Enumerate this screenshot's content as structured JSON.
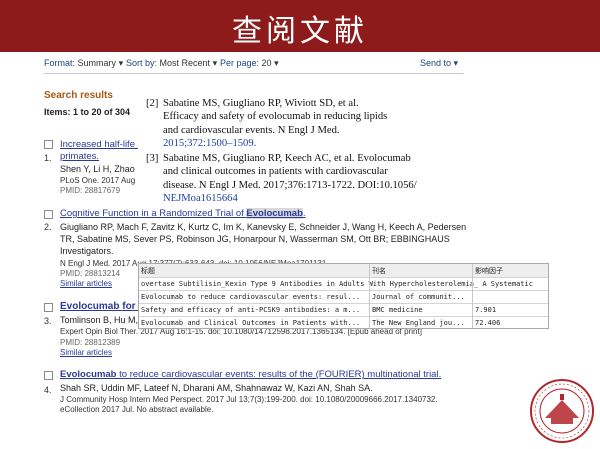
{
  "slide": {
    "title": "查阅文献"
  },
  "toolbar": {
    "format_label": "Format:",
    "format_value": "Summary",
    "sort_label": "Sort by:",
    "sort_value": "Most Recent",
    "per_page_label": "Per page:",
    "per_page_value": "20",
    "send_to": "Send to"
  },
  "results_header": {
    "title": "Search results",
    "items": "Items: 1 to 20 of 304"
  },
  "results": [
    {
      "title_parts": [
        "Increased half-life a",
        "primates."
      ],
      "number": "1.",
      "authors": "Shen Y, Li H, Zhao I",
      "journal": "PLoS One. 2017 Aug 1",
      "pmid": "PMID: 28817679"
    },
    {
      "title_prefix": "Cognitive Function in a Randomized Trial of ",
      "title_highlight": "Evolocumab",
      "title_suffix": ".",
      "number": "2.",
      "authors_1": "Giugliano RP, Mach F, Zavitz K, Kurtz C, Im K, Kanevsky E, Schneider J, Wang H, Keech A, Pedersen",
      "authors_2": "TR, Sabatine MS, Sever PS, Robinson JG, Honarpour N, Wasserman SM, Ott BR; EBBINGHAUS",
      "authors_3": "Investigators.",
      "journal": "N Engl J Med. 2017 Aug 17;377(7):633-643. doi: 10.1056/NEJMoa1701131.",
      "pmid": "PMID: 28813214",
      "similar": "Similar articles"
    },
    {
      "title": "Evolocumab for th",
      "number": "3.",
      "authors": "Tomlinson B, Hu M,",
      "journal": "Expert Opin Biol Ther. 2017 Aug 16:1-15. doi: 10.1080/14712598.2017.1365134. [Epub ahead of print]",
      "pmid": "PMID: 28812389",
      "similar": "Similar articles"
    },
    {
      "title_highlight": "Evolocumab",
      "title_suffix": " to reduce cardiovascular events: results of the (FOURIER) multinational trial.",
      "number": "4.",
      "authors": "Shah SR, Uddin MF, Lateef N, Dharani AM, Shahnawaz W, Kazi AN, Shah SA.",
      "journal_1": "J Community Hosp Intern Med Perspect. 2017 Jul 13;7(3):199-200. doi: 10.1080/20009666.2017.1340732.",
      "journal_2": "eCollection 2017 Jul. No abstract available."
    }
  ],
  "references": [
    {
      "number": "[2]",
      "lines": [
        "Sabatine MS, Giugliano RP, Wiviott SD, et al.",
        "Efficacy and safety of evolocumab in reducing lipids",
        "and cardiovascular events. N Engl J Med.",
        "2015;372:1500–1509."
      ]
    },
    {
      "number": "[3]",
      "lines": [
        "Sabatine MS, Giugliano RP, Keech AC, et al. Evolocumab",
        "and clinical outcomes in patients with cardiovascular",
        "disease. N Engl J Med. 2017;376:1713-1722. DOI:10.1056/",
        "NEJMoa1615664"
      ]
    }
  ],
  "table": {
    "headers": [
      "标题",
      "刊名",
      "影响因子"
    ],
    "rows": [
      [
        "overtase Subtilisin_Kexin Type 9 Antibodies in Adults With Hypercholesterolemia_ A Systematic",
        "",
        ""
      ],
      [
        "Evolocumab to reduce cardiovascular events: resul...",
        "Journal of communit...",
        ""
      ],
      [
        "Safety and efficacy of anti-PCSK9 antibodies: a m...",
        "BMC medicine",
        "7.901"
      ],
      [
        "Evolocumab and Clinical Outcomes in Patients with...",
        "The New England jou...",
        "72.406"
      ]
    ]
  },
  "colors": {
    "banner": "#8e1b1c",
    "link": "#2b3a97",
    "results_header": "#a35a14",
    "seal": "#b3262a"
  }
}
